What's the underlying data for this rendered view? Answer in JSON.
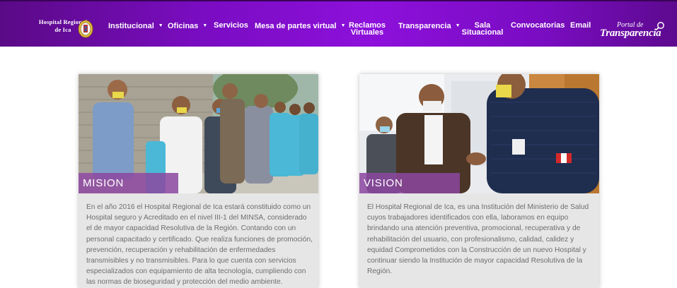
{
  "brand": {
    "name_line1": "Hospital Regional",
    "name_line2": "de Ica",
    "logo_icon": "hospital-seal-icon"
  },
  "nav": {
    "institucional": "Institucional",
    "oficinas": "Oficinas",
    "servicios": "Servicios",
    "mesa_partes": "Mesa de partes virtual",
    "reclamos_line1": "Reclamos",
    "reclamos_line2": "Virtuales",
    "transparencia": "Transparencia",
    "sala_line1": "Sala",
    "sala_line2": "Situacional",
    "convocatorias": "Convocatorias",
    "email": "Email",
    "caret_icon": "caret-down-icon"
  },
  "portal": {
    "small": "Portal de",
    "big": "Transparencia",
    "icon": "magnifier-icon"
  },
  "mision": {
    "title": "MISION",
    "text": "En el año 2016 el Hospital Regional de Ica estará constituido como un Hospital seguro y Acreditado en el nivel III-1 del MINSA, considerado el de mayor capacidad Resolutiva de la Región. Contando con un personal capacitado y certificado. Que realiza funciones de promoción, prevención, recuperación y rehabilitación de enfermedades transmisibles y no transmisibles. Para lo que cuenta con servicios especializados con equipamiento de alta tecnología, cumpliendo con las normas de bioseguridad y protección del medio ambiente."
  },
  "vision": {
    "title": "VISION",
    "text": "El Hospital Regional de Ica, es una Institución del Ministerio de Salud cuyos trabajadores identificados con ella, laboramos en equipo brindando una atención preventiva, promocional, recuperativa y de rehabilitación del usuario, con profesionalismo, calidad, calidez y equidad Comprometidos con la Construcción de un nuevo Hospital y continuar siendo la Institución de mayor capacidad Resolutiva de la Región."
  },
  "colors": {
    "nav_gradient_center": "#8d10db",
    "nav_gradient_edge": "#5a0a86",
    "label_bg": "#8c46a0",
    "card_bg": "#e6e6e6",
    "text": "#6d6d6d"
  }
}
